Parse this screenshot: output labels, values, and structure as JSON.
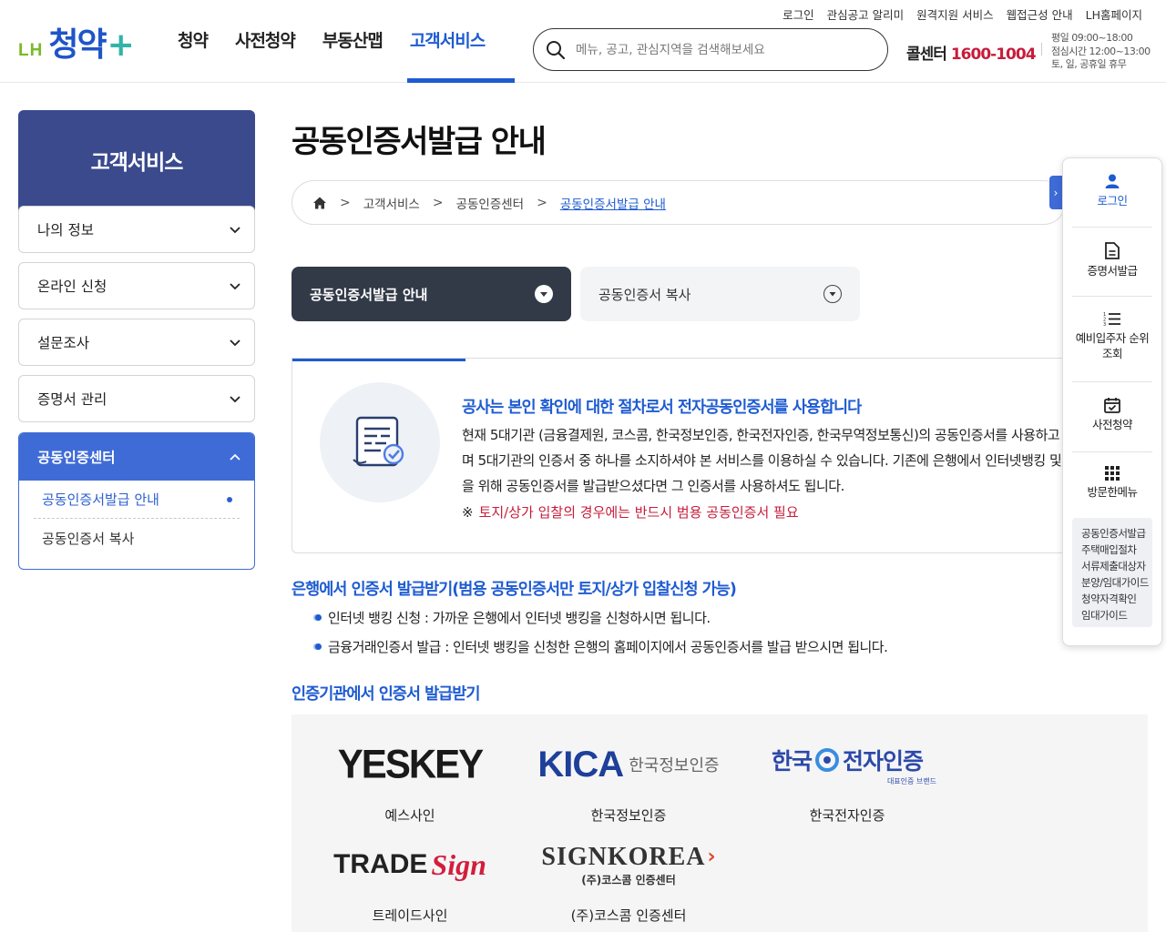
{
  "header": {
    "util_links": [
      "로그인",
      "관심공고 알리미",
      "원격지원 서비스",
      "웹접근성 안내",
      "LH홈페이지"
    ],
    "logo": {
      "prefix": "LH",
      "main": "청약",
      "suffix": "+"
    },
    "gnb": [
      "청약",
      "사전청약",
      "부동산맵",
      "고객서비스"
    ],
    "search_placeholder": "메뉴, 공고, 관심지역을 검색해보세요",
    "callcenter_label": "콜센터",
    "callcenter_number": "1600-1004",
    "hours": [
      "평일 09:00~18:00",
      "점심시간 12:00~13:00",
      "토, 일, 공휴일 휴무"
    ]
  },
  "lnb": {
    "title": "고객서비스",
    "items": [
      "나의 정보",
      "온라인 신청",
      "설문조사",
      "증명서 관리"
    ],
    "active": {
      "label": "공동인증센터",
      "subitems": [
        "공동인증서발급 안내",
        "공동인증서 복사"
      ]
    }
  },
  "main": {
    "title": "공동인증서발급 안내",
    "breadcrumb": [
      "고객서비스",
      "공동인증센터",
      "공동인증서발급 안내"
    ],
    "tabs": [
      "공동인증서발급 안내",
      "공동인증서 복사"
    ],
    "info": {
      "headline": "공사는 본인 확인에 대한 절차로서 전자공동인증서를 사용합니다",
      "body": "현재 5대기관 (금융결제원, 코스콤, 한국정보인증, 한국전자인증, 한국무역정보통신)의 공동인증서를 사용하고 있으며 5대기관의 인증서 중 하나를 소지하셔야 본 서비스를 이용하실 수 있습니다. 기존에 은행에서 인터넷뱅킹 및 청약을 위해 공동인증서를 발급받으셨다면 그 인증서를 사용하셔도 됩니다.",
      "note_mark": "※",
      "note": "토지/상가 입찰의 경우에는 반드시 범용 공동인증서 필요"
    },
    "bank_section": {
      "title": "은행에서 인증서 발급받기(범용 공동인증서만 토지/상가 입찰신청 가능)",
      "bullets": [
        "인터넷 뱅킹 신청 : 가까운 은행에서 인터넷 뱅킹을 신청하시면 됩니다.",
        "금융거래인증서 발급 : 인터넷 뱅킹을 신청한 은행의 홈페이지에서 공동인증서를 발급 받으시면 됩니다."
      ]
    },
    "agency_section": {
      "title": "인증기관에서 인증서 발급받기",
      "agencies": [
        {
          "logo": "YESKEY",
          "name": "예스사인"
        },
        {
          "logo_a": "KICA",
          "logo_b": "한국정보인증",
          "name": "한국정보인증"
        },
        {
          "logo_a": "한국",
          "logo_b": "전자인증",
          "logo_c": "대표인증 브랜드",
          "name": "한국전자인증"
        },
        {
          "logo_a": "TRADE",
          "logo_b": "Sign",
          "name": "트레이드사인"
        },
        {
          "logo_a": "SIGNKOREA",
          "logo_b": "(주)코스콤 인증센터",
          "name": "(주)코스콤 인증센터"
        }
      ]
    }
  },
  "quick_menu": {
    "items": [
      "로그인",
      "증명서발급",
      "예비입주자 순위 조회",
      "사전청약",
      "방문한메뉴"
    ],
    "recent": [
      "공동인증서발급",
      "주택매입절차",
      "서류제출대상자",
      "분양/임대가이드",
      "청약자격확인",
      "임대가이드"
    ]
  },
  "colors": {
    "brand_blue": "#1e5bd1",
    "lnb_navy": "#3b4a8d",
    "accent_red": "#c71c3b",
    "tab_dark": "#323a48"
  }
}
